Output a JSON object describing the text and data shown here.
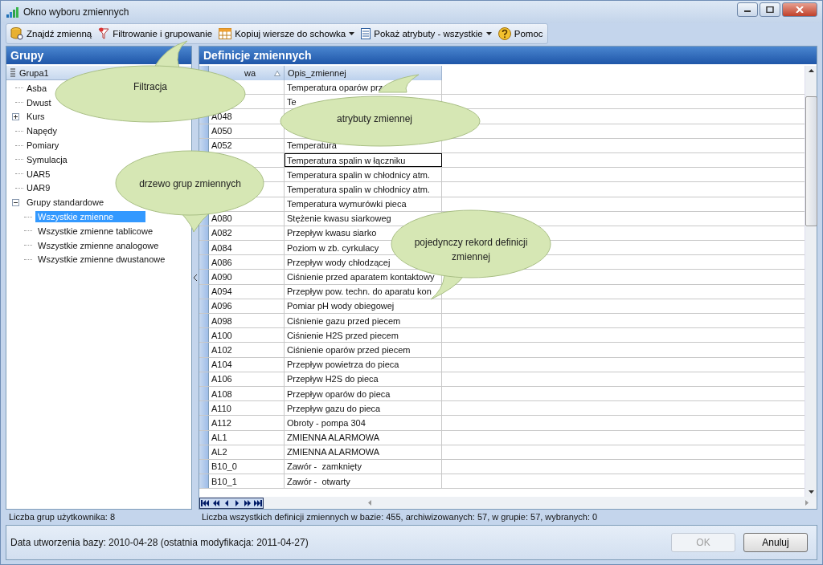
{
  "window": {
    "title": "Okno wyboru zmiennych"
  },
  "toolbar": [
    {
      "label": "Znajdź zmienną",
      "kind": "button"
    },
    {
      "label": "Filtrowanie i grupowanie",
      "kind": "button"
    },
    {
      "label": "Kopiuj wiersze do schowka",
      "kind": "dropdown"
    },
    {
      "label": "Pokaż atrybuty - wszystkie",
      "kind": "dropdown"
    },
    {
      "label": "Pomoc",
      "kind": "button"
    }
  ],
  "groups": {
    "title": "Grupy",
    "column": "Grupa1",
    "items": [
      {
        "label": "Asba",
        "selected": false
      },
      {
        "label": "Dwust",
        "selected": false
      },
      {
        "label": "Kurs",
        "selected": false,
        "expanded": false
      },
      {
        "label": "Napędy",
        "selected": false
      },
      {
        "label": "Pomiary",
        "selected": false
      },
      {
        "label": "Symulacja",
        "selected": false
      },
      {
        "label": "UAR5",
        "selected": false
      },
      {
        "label": "UAR9",
        "selected": false
      },
      {
        "label": "Grupy standardowe",
        "selected": false,
        "expanded": true,
        "children": [
          {
            "label": "Wszystkie zmienne",
            "selected": true
          },
          {
            "label": "Wszystkie zmienne tablicowe",
            "selected": false
          },
          {
            "label": "Wszystkie zmienne analogowe",
            "selected": false
          },
          {
            "label": "Wszystkie zmienne dwustanowe",
            "selected": false
          }
        ]
      }
    ]
  },
  "definitions": {
    "title": "Definicje zmiennych",
    "columns": [
      {
        "label": "wa",
        "sorted": true
      },
      {
        "label": "Opis_zmiennej",
        "sorted": false
      }
    ],
    "rows": [
      {
        "cells": [
          "",
          "Temperatura oparów prz"
        ]
      },
      {
        "cells": [
          "",
          "Te"
        ]
      },
      {
        "cells": [
          "A048",
          ""
        ]
      },
      {
        "cells": [
          "A050",
          ""
        ]
      },
      {
        "cells": [
          "A052",
          "Temperatura"
        ]
      },
      {
        "cells": [
          "",
          "Temperatura spalin w łączniku"
        ],
        "focused": true
      },
      {
        "cells": [
          "",
          "Temperatura spalin w chłodnicy atm."
        ]
      },
      {
        "cells": [
          "",
          "Temperatura spalin w chłodnicy atm."
        ]
      },
      {
        "cells": [
          "",
          "Temperatura wymurówki pieca"
        ]
      },
      {
        "cells": [
          "A080",
          "Stężenie kwasu siarkoweg"
        ]
      },
      {
        "cells": [
          "A082",
          "Przepływ kwasu siarko"
        ]
      },
      {
        "cells": [
          "A084",
          "Poziom w zb. cyrkulacy"
        ]
      },
      {
        "cells": [
          "A086",
          "Przepływ wody chłodzącej"
        ]
      },
      {
        "cells": [
          "A090",
          "Ciśnienie przed aparatem kontaktowy"
        ]
      },
      {
        "cells": [
          "A094",
          "Przepływ pow. techn. do aparatu kon"
        ]
      },
      {
        "cells": [
          "A096",
          "Pomiar pH wody obiegowej"
        ]
      },
      {
        "cells": [
          "A098",
          "Ciśnienie gazu przed piecem"
        ]
      },
      {
        "cells": [
          "A100",
          "Ciśnienie H2S przed piecem"
        ]
      },
      {
        "cells": [
          "A102",
          "Ciśnienie oparów przed piecem"
        ]
      },
      {
        "cells": [
          "A104",
          "Przepływ powietrza do pieca"
        ]
      },
      {
        "cells": [
          "A106",
          "Przepływ H2S do pieca"
        ]
      },
      {
        "cells": [
          "A108",
          "Przepływ oparów do pieca"
        ]
      },
      {
        "cells": [
          "A110",
          "Przepływ gazu do pieca"
        ]
      },
      {
        "cells": [
          "A112",
          "Obroty - pompa 304"
        ]
      },
      {
        "cells": [
          "AL1",
          "ZMIENNA ALARMOWA"
        ]
      },
      {
        "cells": [
          "AL2",
          "ZMIENNA ALARMOWA"
        ]
      },
      {
        "cells": [
          "B10_0",
          "Zawór -  zamknięty"
        ]
      },
      {
        "cells": [
          "B10_1",
          "Zawór -  otwarty"
        ]
      }
    ]
  },
  "status": {
    "groups": "Liczba grup użytkownika: 8",
    "definitions": "Liczba wszystkich definicji zmiennych w bazie: 455, archiwizowanych: 57, w grupie: 57, wybranych: 0"
  },
  "footer": {
    "info": "Data utworzenia bazy: 2010-04-28 (ostatnia modyfikacja: 2011-04-27)",
    "buttons": [
      {
        "label": "OK",
        "disabled": true
      },
      {
        "label": "Anuluj",
        "disabled": false
      }
    ]
  },
  "callouts": [
    "Filtracja",
    "atrybuty zmiennej",
    "drzewo grup zmiennych",
    "pojedynczy rekord definicji zmiennej"
  ]
}
